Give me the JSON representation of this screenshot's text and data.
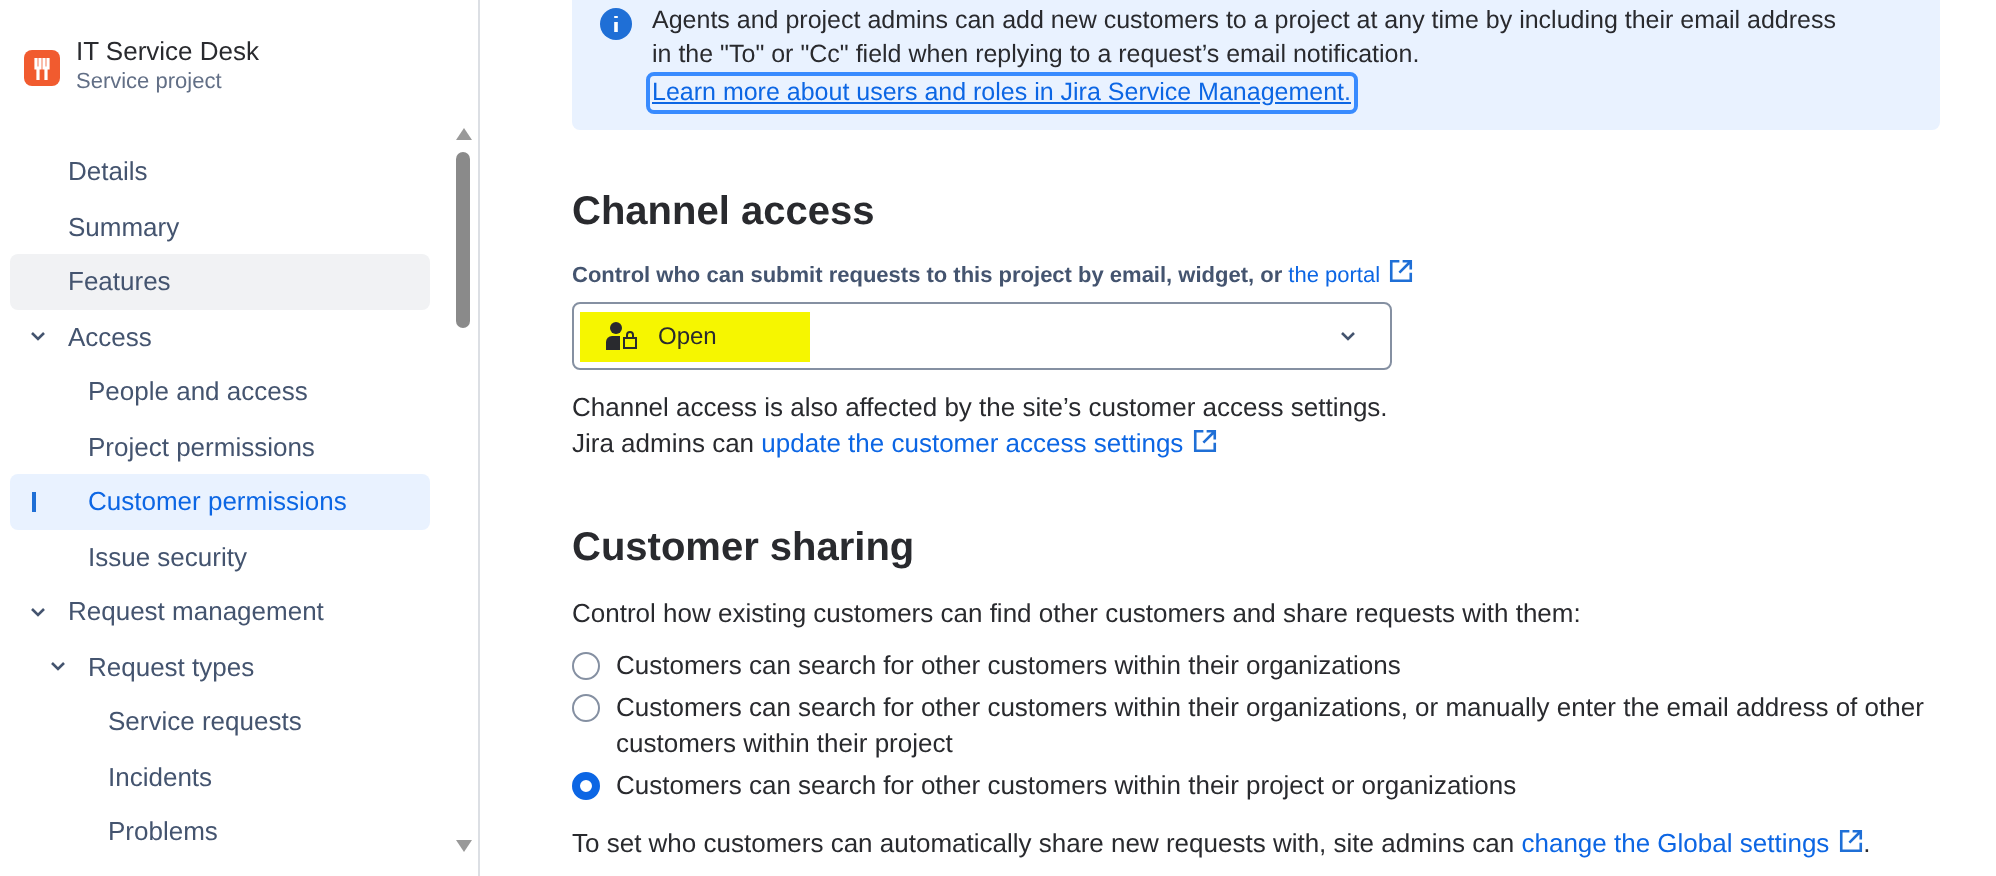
{
  "project": {
    "name": "IT Service Desk",
    "type": "Service project"
  },
  "sidebar": {
    "items": [
      {
        "label": "Details",
        "selected": false,
        "hovered": false
      },
      {
        "label": "Summary",
        "selected": false,
        "hovered": false
      },
      {
        "label": "Features",
        "selected": false,
        "hovered": true
      },
      {
        "label": "Access",
        "expanded": true,
        "children": [
          {
            "label": "People and access",
            "selected": false,
            "hovered": false
          },
          {
            "label": "Project permissions",
            "selected": false,
            "hovered": false
          },
          {
            "label": "Customer permissions",
            "selected": true,
            "hovered": false
          },
          {
            "label": "Issue security",
            "selected": false,
            "hovered": false
          }
        ]
      },
      {
        "label": "Request management",
        "expanded": true,
        "children": [
          {
            "label": "Request types",
            "expanded": true,
            "children": [
              {
                "label": "Service requests",
                "selected": false,
                "hovered": false
              },
              {
                "label": "Incidents",
                "selected": false,
                "hovered": false
              },
              {
                "label": "Problems",
                "selected": false,
                "hovered": false
              }
            ]
          }
        ]
      }
    ]
  },
  "info_banner": {
    "lines": [
      "Agents and project admins can add new customers to a project at any time by including their email address",
      "in the \"To\" or \"Cc\" field when replying to a request’s email notification."
    ],
    "link": "Learn more about users and roles in Jira Service Management."
  },
  "channel_access": {
    "title": "Channel access",
    "label": "Control who can submit requests to this project by email, widget, or",
    "label_link": "the portal",
    "select_value": "Open",
    "highlighted": true,
    "note_lines": [
      "Channel access is also affected by the site’s customer access settings."
    ],
    "note2": "Jira admins can",
    "note2_link": "update the customer access settings"
  },
  "customer_sharing": {
    "title": "Customer sharing",
    "description": "Control how existing customers can find other customers and share requests with them:",
    "options": [
      {
        "label": "Customers can search for other customers within their organizations",
        "selected": false
      },
      {
        "label": "Customers can search for other customers within their organizations, or manually enter the email address of other customers within their project",
        "selected": false
      },
      {
        "label": "Customers can search for other customers within their project or organizations",
        "selected": true
      }
    ],
    "footer": "To set who customers can automatically share new requests with, site admins can",
    "footer_link": "change the Global settings",
    "footer_end": "."
  }
}
